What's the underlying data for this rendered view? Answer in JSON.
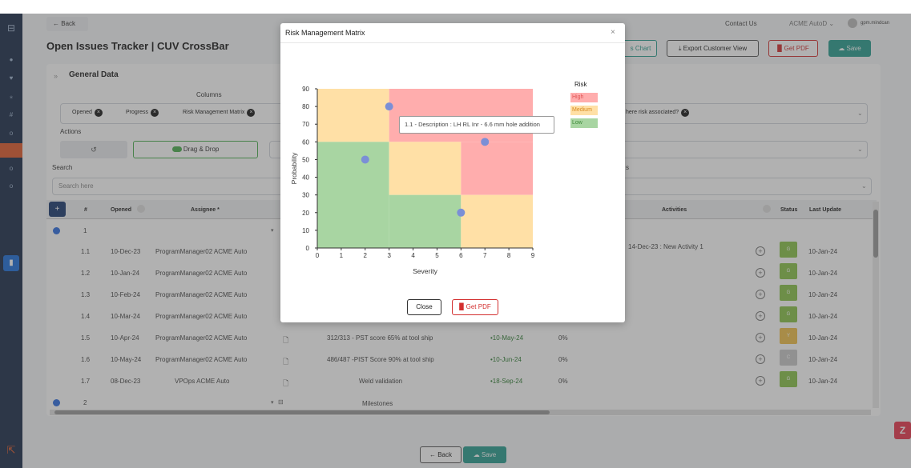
{
  "app": {
    "back_label": "Back",
    "page_title": "Open Issues Tracker | CUV CrossBar",
    "contact_us": "Contact Us",
    "company": "ACME AutoD",
    "username": "gpm.mindcan",
    "toolbar": {
      "chart_partial": "s Chart",
      "export_label": "Export Customer View",
      "pdf_label": "Get PDF",
      "save_label": "Save"
    },
    "general_data": {
      "title": "General Data",
      "columns_label": "Columns",
      "chips": [
        "Opened",
        "Progress",
        "Risk Management Matrix"
      ],
      "chip_right": "here risk associated?",
      "actions_label": "Actions",
      "drag_drop_label": "Drag & Drop",
      "search_label": "Search",
      "search_placeholder": "Search here",
      "s_partial": "s"
    },
    "table": {
      "headers": {
        "num": "#",
        "opened": "Opened",
        "assignee": "Assignee *",
        "activities": "Activities",
        "status": "Status",
        "last_update": "Last Update"
      },
      "group1": "1",
      "group2": "2",
      "milestones": "Milestones",
      "row1_activity": "14-Dec-23 : New Activity 1",
      "rows": [
        {
          "id": "1.1",
          "opened": "10-Dec-23",
          "assignee": "ProgramManager02 ACME Auto",
          "desc": "",
          "due": "",
          "progress": "",
          "status": "G",
          "last": "10-Jan-24"
        },
        {
          "id": "1.2",
          "opened": "10-Jan-24",
          "assignee": "ProgramManager02 ACME Auto",
          "desc": "",
          "due": "",
          "progress": "",
          "status": "G",
          "last": "10-Jan-24"
        },
        {
          "id": "1.3",
          "opened": "10-Feb-24",
          "assignee": "ProgramManager02 ACME Auto",
          "desc": "",
          "due": "",
          "progress": "",
          "status": "G",
          "last": "10-Jan-24"
        },
        {
          "id": "1.4",
          "opened": "10-Mar-24",
          "assignee": "ProgramManager02 ACME Auto",
          "desc": "",
          "due": "",
          "progress": "",
          "status": "G",
          "last": "10-Jan-24"
        },
        {
          "id": "1.5",
          "opened": "10-Apr-24",
          "assignee": "ProgramManager02 ACME Auto",
          "desc": "312/313 - PST score 65% at tool ship",
          "due": "•10-May-24",
          "progress": "0%",
          "status": "Y",
          "last": "10-Jan-24"
        },
        {
          "id": "1.6",
          "opened": "10-May-24",
          "assignee": "ProgramManager02 ACME Auto",
          "desc": "486/487 -PIST Score 90% at tool ship",
          "due": "•10-Jun-24",
          "progress": "0%",
          "status": "C",
          "last": "10-Jan-24"
        },
        {
          "id": "1.7",
          "opened": "08-Dec-23",
          "assignee": "VPOps ACME Auto",
          "desc": "Weld validation",
          "due": "•18-Sep-24",
          "progress": "0%",
          "status": "G",
          "last": "10-Jan-24"
        }
      ]
    },
    "bottom": {
      "back_label": "Back",
      "save_label": "Save"
    }
  },
  "modal": {
    "title": "Risk Management Matrix",
    "close_label": "Close",
    "pdf_label": "Get PDF",
    "tooltip": "1.1 - Description : LH RL Inr - 6.6 mm hole addition"
  },
  "colors": {
    "high": "#ffadad",
    "medium": "#ffe0a6",
    "low": "#a8d5a2",
    "point": "#7b8fd6",
    "teal": "#2a9d8f",
    "pdf_red": "#d32f2f",
    "status_green": "#8bc34a",
    "status_yellow": "#f0c04a",
    "status_grey": "#c9c9c9"
  },
  "chart_data": {
    "type": "scatter",
    "xlabel": "Severity",
    "ylabel": "Probability",
    "xlim": [
      0,
      9
    ],
    "ylim": [
      0,
      90
    ],
    "x_ticks": [
      0,
      1,
      2,
      3,
      4,
      5,
      6,
      7,
      8,
      9
    ],
    "y_ticks": [
      0,
      10,
      20,
      30,
      40,
      50,
      60,
      70,
      80,
      90
    ],
    "legend_title": "Risk",
    "legend": [
      {
        "name": "High",
        "color": "#ffadad",
        "text_color": "#e05555"
      },
      {
        "name": "Medium",
        "color": "#ffe0a6",
        "text_color": "#d68a22"
      },
      {
        "name": "Low",
        "color": "#a8d5a2",
        "text_color": "#3f8a3a"
      }
    ],
    "zones": [
      {
        "x0": 0,
        "x1": 3,
        "y0": 60,
        "y1": 90,
        "level": "Medium"
      },
      {
        "x0": 3,
        "x1": 9,
        "y0": 60,
        "y1": 90,
        "level": "High"
      },
      {
        "x0": 0,
        "x1": 3,
        "y0": 0,
        "y1": 60,
        "level": "Low"
      },
      {
        "x0": 3,
        "x1": 6,
        "y0": 30,
        "y1": 60,
        "level": "Medium"
      },
      {
        "x0": 6,
        "x1": 9,
        "y0": 30,
        "y1": 60,
        "level": "High"
      },
      {
        "x0": 3,
        "x1": 6,
        "y0": 0,
        "y1": 30,
        "level": "Low"
      },
      {
        "x0": 6,
        "x1": 9,
        "y0": 0,
        "y1": 30,
        "level": "Medium"
      }
    ],
    "points": [
      {
        "x": 2,
        "y": 50
      },
      {
        "x": 3,
        "y": 80
      },
      {
        "x": 6,
        "y": 20
      },
      {
        "x": 7,
        "y": 60
      }
    ]
  }
}
